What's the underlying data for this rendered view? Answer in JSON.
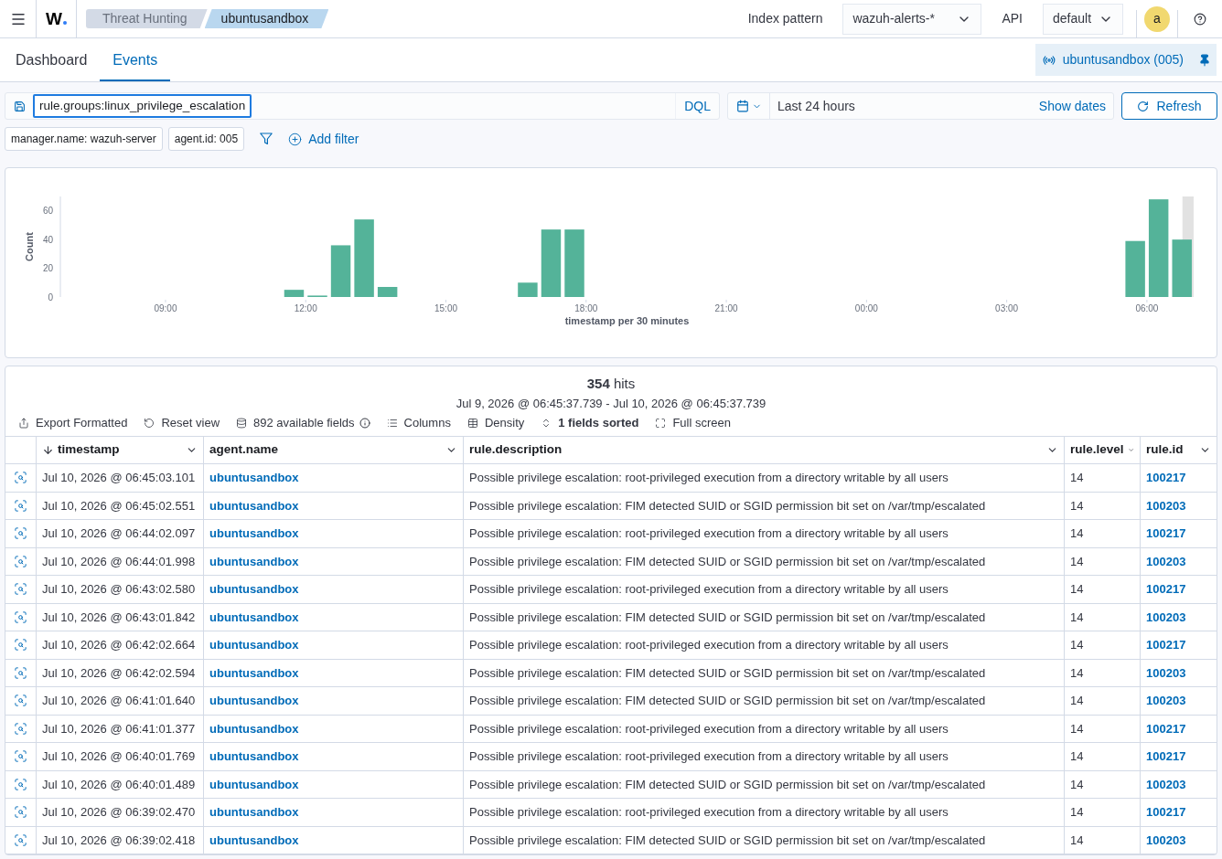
{
  "header": {
    "logo": "W",
    "breadcrumbs": [
      {
        "label": "Threat Hunting",
        "selected": false
      },
      {
        "label": "ubuntusandbox",
        "selected": true
      }
    ],
    "index_pattern": {
      "label": "Index pattern",
      "value": "wazuh-alerts-*"
    },
    "api": {
      "label": "API",
      "value": "default"
    },
    "avatar": "a"
  },
  "tabs": [
    {
      "label": "Dashboard",
      "selected": false
    },
    {
      "label": "Events",
      "selected": true
    }
  ],
  "pinned_agent": "ubuntusandbox (005)",
  "query_bar": {
    "value": "rule.groups:linux_privilege_escalation",
    "language": "DQL"
  },
  "date_picker": {
    "range": "Last 24 hours",
    "show_dates": "Show dates"
  },
  "refresh_button": "Refresh",
  "filters": [
    {
      "label": "manager.name: wazuh-server"
    },
    {
      "label": "agent.id: 005"
    }
  ],
  "add_filter": "Add filter",
  "histogram": {
    "chart_data": {
      "type": "bar",
      "xlabel": "timestamp per 30 minutes",
      "ylabel": "Count",
      "x": [
        "2026-07-09T11:45",
        "2026-07-09T12:15",
        "2026-07-09T12:45",
        "2026-07-09T13:15",
        "2026-07-09T13:45",
        "2026-07-09T16:45",
        "2026-07-09T17:15",
        "2026-07-09T17:45",
        "2026-07-10T05:45",
        "2026-07-10T06:15",
        "2026-07-10T06:45"
      ],
      "values": [
        5,
        1,
        36,
        54,
        7,
        10,
        47,
        47,
        39,
        68,
        40
      ],
      "xlim": [
        "2026-07-09T06:45",
        "2026-07-10T07:00"
      ],
      "ylim": [
        0,
        70
      ],
      "xticks": [
        {
          "value": "2026-07-09T09:00",
          "label": "09:00"
        },
        {
          "value": "2026-07-09T12:00",
          "label": "12:00"
        },
        {
          "value": "2026-07-09T15:00",
          "label": "15:00"
        },
        {
          "value": "2026-07-09T18:00",
          "label": "18:00"
        },
        {
          "value": "2026-07-09T21:00",
          "label": "21:00"
        },
        {
          "value": "2026-07-10T00:00",
          "label": "00:00"
        },
        {
          "value": "2026-07-10T03:00",
          "label": "03:00"
        },
        {
          "value": "2026-07-10T06:00",
          "label": "06:00"
        }
      ],
      "yticks": [
        0,
        20,
        40,
        60
      ],
      "bands": [
        {
          "axis": "x",
          "from": "2026-07-10T06:45:37",
          "to": "2026-07-10T07:00"
        }
      ]
    }
  },
  "results": {
    "hits": "**354** hits",
    "time_range": "Jul 9, 2026 @ 06:45:37.739 - Jul 10, 2026 @ 06:45:37.739",
    "toolbar": [
      {
        "kind": "export",
        "label": "Export Formatted"
      },
      {
        "kind": "reset",
        "label": "Reset view"
      },
      {
        "kind": "fields",
        "label": "892 available fields"
      },
      {
        "kind": "columns",
        "label": "Columns"
      },
      {
        "kind": "density",
        "label": "Density"
      },
      {
        "kind": "sort",
        "label": "1 fields sorted"
      },
      {
        "kind": "fullscreen",
        "label": "Full screen"
      }
    ],
    "table": {
      "columns": [
        {
          "label": "timestamp",
          "sorted": true
        },
        {
          "label": "agent.name",
          "sorted": false
        },
        {
          "label": "rule.description",
          "sorted": false
        },
        {
          "label": "rule.level",
          "sorted": false
        },
        {
          "label": "rule.id",
          "sorted": false
        }
      ],
      "rows": [
        {
          "timestamp": "Jul 10, 2026 @ 06:45:03.101",
          "agent": "ubuntusandbox",
          "description": "Possible privilege escalation: root-privileged execution from a directory writable by all users",
          "level": "14",
          "rule_id": "100217"
        },
        {
          "timestamp": "Jul 10, 2026 @ 06:45:02.551",
          "agent": "ubuntusandbox",
          "description": "Possible privilege escalation: FIM detected SUID or SGID permission bit set on /var/tmp/escalated",
          "level": "14",
          "rule_id": "100203"
        },
        {
          "timestamp": "Jul 10, 2026 @ 06:44:02.097",
          "agent": "ubuntusandbox",
          "description": "Possible privilege escalation: root-privileged execution from a directory writable by all users",
          "level": "14",
          "rule_id": "100217"
        },
        {
          "timestamp": "Jul 10, 2026 @ 06:44:01.998",
          "agent": "ubuntusandbox",
          "description": "Possible privilege escalation: FIM detected SUID or SGID permission bit set on /var/tmp/escalated",
          "level": "14",
          "rule_id": "100203"
        },
        {
          "timestamp": "Jul 10, 2026 @ 06:43:02.580",
          "agent": "ubuntusandbox",
          "description": "Possible privilege escalation: root-privileged execution from a directory writable by all users",
          "level": "14",
          "rule_id": "100217"
        },
        {
          "timestamp": "Jul 10, 2026 @ 06:43:01.842",
          "agent": "ubuntusandbox",
          "description": "Possible privilege escalation: FIM detected SUID or SGID permission bit set on /var/tmp/escalated",
          "level": "14",
          "rule_id": "100203"
        },
        {
          "timestamp": "Jul 10, 2026 @ 06:42:02.664",
          "agent": "ubuntusandbox",
          "description": "Possible privilege escalation: root-privileged execution from a directory writable by all users",
          "level": "14",
          "rule_id": "100217"
        },
        {
          "timestamp": "Jul 10, 2026 @ 06:42:02.594",
          "agent": "ubuntusandbox",
          "description": "Possible privilege escalation: FIM detected SUID or SGID permission bit set on /var/tmp/escalated",
          "level": "14",
          "rule_id": "100203"
        },
        {
          "timestamp": "Jul 10, 2026 @ 06:41:01.640",
          "agent": "ubuntusandbox",
          "description": "Possible privilege escalation: FIM detected SUID or SGID permission bit set on /var/tmp/escalated",
          "level": "14",
          "rule_id": "100203"
        },
        {
          "timestamp": "Jul 10, 2026 @ 06:41:01.377",
          "agent": "ubuntusandbox",
          "description": "Possible privilege escalation: root-privileged execution from a directory writable by all users",
          "level": "14",
          "rule_id": "100217"
        },
        {
          "timestamp": "Jul 10, 2026 @ 06:40:01.769",
          "agent": "ubuntusandbox",
          "description": "Possible privilege escalation: root-privileged execution from a directory writable by all users",
          "level": "14",
          "rule_id": "100217"
        },
        {
          "timestamp": "Jul 10, 2026 @ 06:40:01.489",
          "agent": "ubuntusandbox",
          "description": "Possible privilege escalation: FIM detected SUID or SGID permission bit set on /var/tmp/escalated",
          "level": "14",
          "rule_id": "100203"
        },
        {
          "timestamp": "Jul 10, 2026 @ 06:39:02.470",
          "agent": "ubuntusandbox",
          "description": "Possible privilege escalation: root-privileged execution from a directory writable by all users",
          "level": "14",
          "rule_id": "100217"
        },
        {
          "timestamp": "Jul 10, 2026 @ 06:39:02.418",
          "agent": "ubuntusandbox",
          "description": "Possible privilege escalation: FIM detected SUID or SGID permission bit set on /var/tmp/escalated",
          "level": "14",
          "rule_id": "100203"
        }
      ]
    }
  }
}
